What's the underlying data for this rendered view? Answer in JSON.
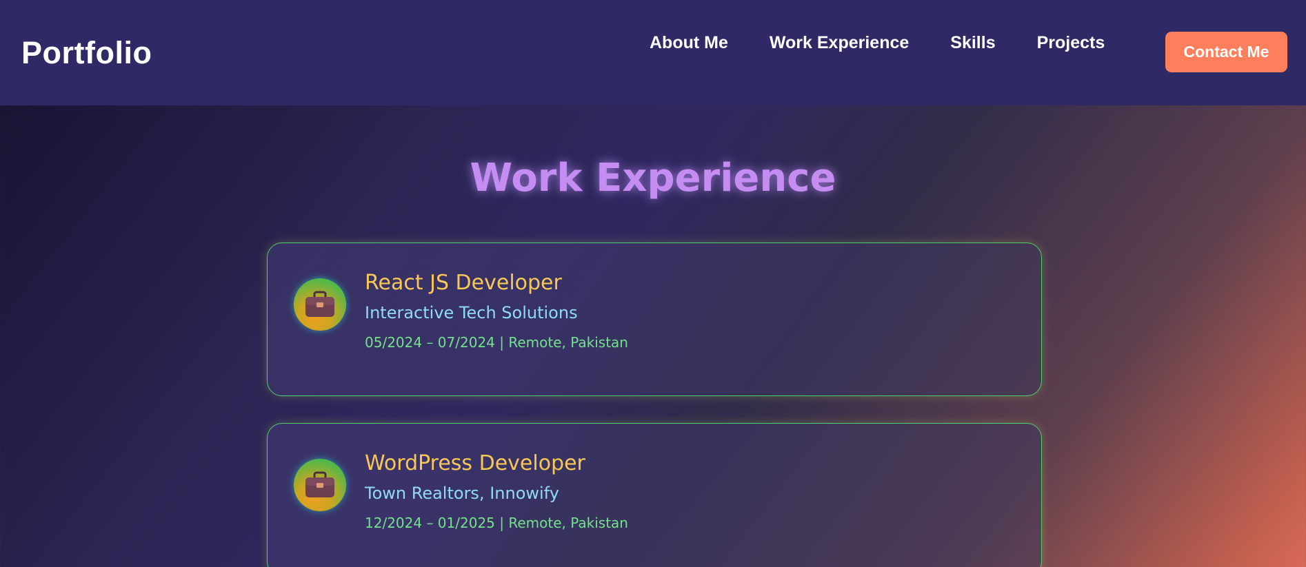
{
  "navbar": {
    "brand": "Portfolio",
    "links": [
      "About Me",
      "Work Experience",
      "Skills",
      "Projects"
    ],
    "cta": "Contact Me"
  },
  "section": {
    "title": "Work Experience"
  },
  "experiences": [
    {
      "icon": "briefcase-icon",
      "title": "React JS Developer",
      "company": "Interactive Tech Solutions",
      "meta": "05/2024 – 07/2024 | Remote, Pakistan"
    },
    {
      "icon": "briefcase-icon",
      "title": "WordPress Developer",
      "company": "Town Realtors, Innowify",
      "meta": "12/2024 – 01/2025 | Remote, Pakistan"
    }
  ],
  "colors": {
    "navbar_bg": "#2f2a66",
    "cta_bg": "#ff7f5c",
    "title": "#c58cf2",
    "job_title": "#f7c857",
    "company": "#8fdcf2",
    "meta": "#74e28c",
    "card_border": "#4bd06b"
  }
}
